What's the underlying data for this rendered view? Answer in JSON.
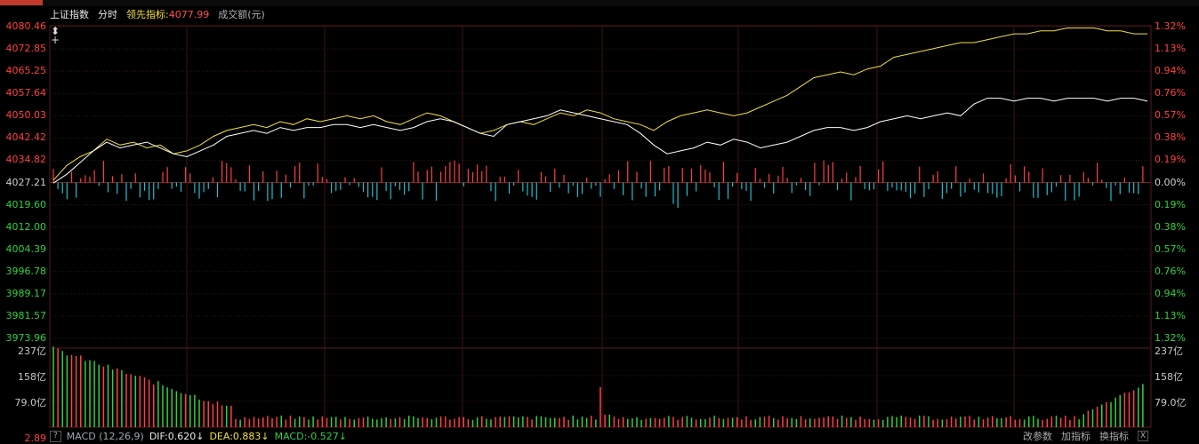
{
  "header": {
    "title": "上证指数",
    "mode": "分时",
    "lead_label": "领先指标:",
    "lead_value": "4077.99",
    "volume_label": "成交额(元)"
  },
  "price_axis": [
    "4080.46",
    "4072.85",
    "4065.25",
    "4057.64",
    "4050.03",
    "4042.42",
    "4034.82",
    "4027.21",
    "4019.60",
    "4012.00",
    "4004.39",
    "3996.78",
    "3989.17",
    "3981.57",
    "3973.96"
  ],
  "pct_axis": [
    "1.32%",
    "1.13%",
    "0.94%",
    "0.76%",
    "0.57%",
    "0.38%",
    "0.19%",
    "0.00%",
    "0.19%",
    "0.38%",
    "0.57%",
    "0.76%",
    "0.94%",
    "1.13%",
    "1.32%"
  ],
  "volume_axis_left": [
    "237亿",
    "158亿",
    "79.0亿",
    "2.89"
  ],
  "volume_axis_right": [
    "237亿",
    "158亿",
    "79.0亿"
  ],
  "macd": {
    "help": "?",
    "name": "MACD (12,26,9)",
    "dif": "DIF:0.620↓",
    "dea": "DEA:0.883↓",
    "macd": "MACD:-0.527↓"
  },
  "buttons": {
    "params": "改参数",
    "add": "加指标",
    "switch": "换指标",
    "close": "X"
  },
  "colors": {
    "up": "#ff4040",
    "down": "#30d040",
    "price_line": "#ffffff",
    "lead_line": "#f0e040",
    "grid": "#3a1010",
    "cyan_bar": "#20c0d0"
  },
  "chart_data": {
    "type": "line",
    "ylim": [
      3973.96,
      4080.46
    ],
    "base": 4027.21,
    "series": [
      {
        "values": [
          4028,
          4033,
          4036,
          4038,
          4042,
          4040,
          4041,
          4039,
          4040,
          4037,
          4038,
          4040,
          4043,
          4045,
          4046,
          4047,
          4046,
          4048,
          4047,
          4049,
          4048,
          4049,
          4050,
          4049,
          4050,
          4048,
          4047,
          4049,
          4051,
          4050,
          4048,
          4046,
          4044,
          4045,
          4047,
          4048,
          4047,
          4049,
          4051,
          4050,
          4052,
          4051,
          4049,
          4048,
          4047,
          4045,
          4048,
          4050,
          4051,
          4052,
          4051,
          4050,
          4051,
          4053,
          4055,
          4057,
          4060,
          4063,
          4064,
          4065,
          4064,
          4066,
          4067,
          4070,
          4071,
          4072,
          4073,
          4074,
          4075,
          4075,
          4076,
          4077,
          4078,
          4078,
          4079,
          4079,
          4080,
          4080,
          4080,
          4079,
          4079,
          4078,
          4078
        ]
      },
      {
        "values": [
          4027,
          4030,
          4034,
          4038,
          4041,
          4039,
          4040,
          4041,
          4039,
          4037,
          4036,
          4038,
          4040,
          4043,
          4044,
          4045,
          4044,
          4046,
          4045,
          4046,
          4046,
          4047,
          4047,
          4046,
          4047,
          4046,
          4045,
          4046,
          4048,
          4049,
          4048,
          4046,
          4044,
          4043,
          4047,
          4048,
          4049,
          4050,
          4052,
          4051,
          4050,
          4049,
          4048,
          4047,
          4044,
          4040,
          4037,
          4038,
          4039,
          4041,
          4040,
          4042,
          4041,
          4039,
          4040,
          4041,
          4043,
          4045,
          4046,
          4046,
          4045,
          4046,
          4048,
          4049,
          4050,
          4049,
          4050,
          4051,
          4050,
          4054,
          4056,
          4056,
          4055,
          4056,
          4056,
          4055,
          4056,
          4056,
          4056,
          4055,
          4056,
          4056,
          4055
        ]
      }
    ]
  }
}
